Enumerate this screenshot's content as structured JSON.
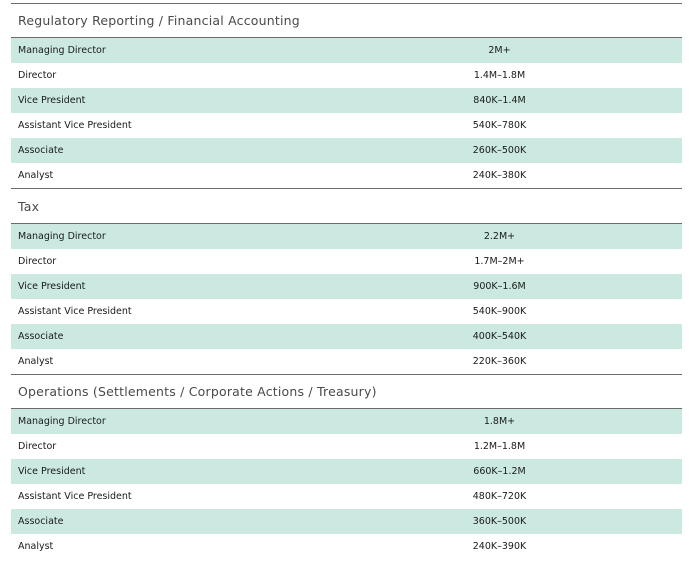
{
  "sections": [
    {
      "title": "Regulatory Reporting / Financial Accounting",
      "rows": [
        {
          "role": "Managing Director",
          "range": "2M+"
        },
        {
          "role": "Director",
          "range": "1.4M–1.8M"
        },
        {
          "role": "Vice President",
          "range": "840K–1.4M"
        },
        {
          "role": "Assistant Vice President",
          "range": "540K–780K"
        },
        {
          "role": "Associate",
          "range": "260K–500K"
        },
        {
          "role": "Analyst",
          "range": "240K–380K"
        }
      ]
    },
    {
      "title": "Tax",
      "rows": [
        {
          "role": "Managing Director",
          "range": "2.2M+"
        },
        {
          "role": "Director",
          "range": "1.7M–2M+"
        },
        {
          "role": "Vice President",
          "range": "900K–1.6M"
        },
        {
          "role": "Assistant Vice President",
          "range": "540K–900K"
        },
        {
          "role": "Associate",
          "range": "400K–540K"
        },
        {
          "role": "Analyst",
          "range": "220K–360K"
        }
      ]
    },
    {
      "title": "Operations (Settlements / Corporate Actions / Treasury)",
      "rows": [
        {
          "role": "Managing Director",
          "range": "1.8M+"
        },
        {
          "role": "Director",
          "range": "1.2M–1.8M"
        },
        {
          "role": "Vice President",
          "range": "660K–1.2M"
        },
        {
          "role": "Assistant Vice President",
          "range": "480K–720K"
        },
        {
          "role": "Associate",
          "range": "360K–500K"
        },
        {
          "role": "Analyst",
          "range": "240K–390K"
        }
      ]
    }
  ],
  "colors": {
    "shaded_row": "#cbe9e0",
    "rule": "#6b6b6b"
  }
}
